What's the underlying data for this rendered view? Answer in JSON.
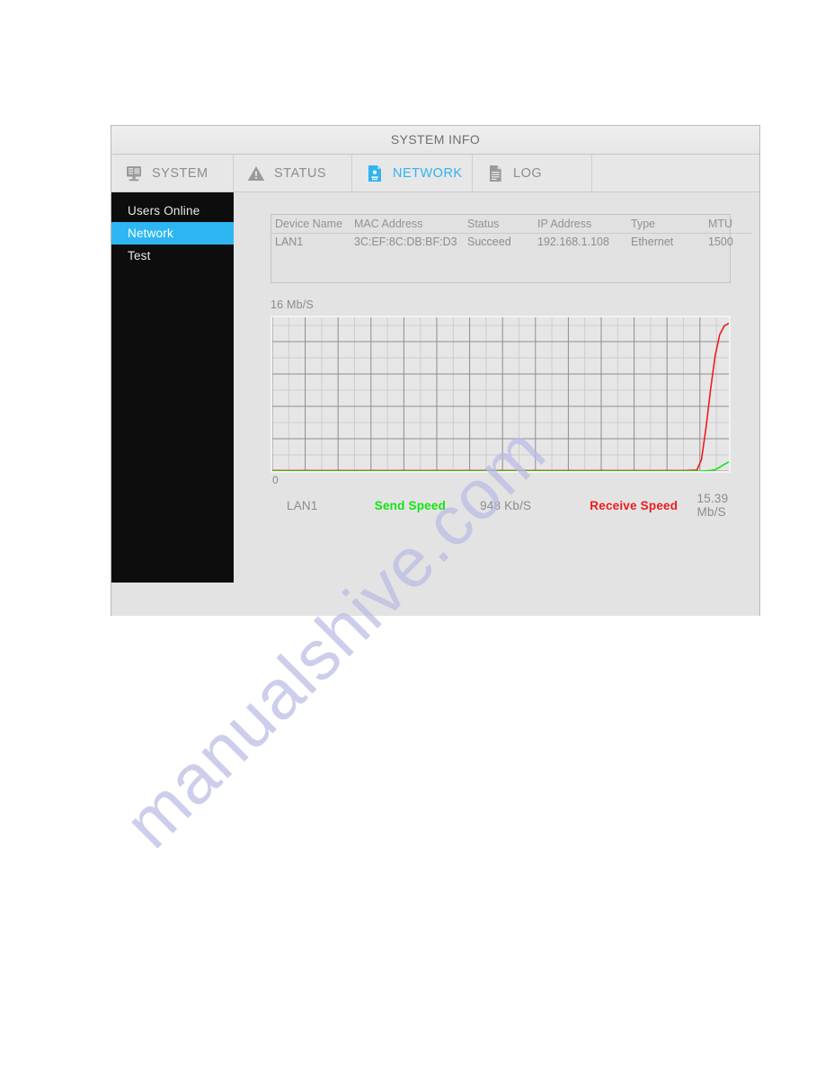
{
  "window": {
    "title": "SYSTEM INFO"
  },
  "tabs": [
    {
      "label": "SYSTEM",
      "icon": "monitor-icon",
      "active": false
    },
    {
      "label": "STATUS",
      "icon": "warning-triangle-icon",
      "active": false
    },
    {
      "label": "NETWORK",
      "icon": "network-card-icon",
      "active": true
    },
    {
      "label": "LOG",
      "icon": "document-icon",
      "active": false
    }
  ],
  "sidebar": {
    "items": [
      {
        "label": "Users Online",
        "selected": false
      },
      {
        "label": "Network",
        "selected": true
      },
      {
        "label": "Test",
        "selected": false
      }
    ]
  },
  "info_table": {
    "headers": [
      "Device Name",
      "MAC Address",
      "Status",
      "IP Address",
      "Type",
      "MTU"
    ],
    "rows": [
      {
        "device_name": "LAN1",
        "mac_address": "3C:EF:8C:DB:BF:D3",
        "status": "Succeed",
        "ip_address": "192.168.1.108",
        "type": "Ethernet",
        "mtu": "1500"
      }
    ]
  },
  "chart_data": {
    "type": "line",
    "title": "",
    "xlabel": "",
    "ylabel": "16 Mb/S",
    "axis_max_label": "16 Mb/S",
    "axis_min_label": "0",
    "ylim": [
      0,
      16
    ],
    "grid": true,
    "legend_position": "bottom",
    "series": [
      {
        "name": "Send Speed",
        "color": "#12e512",
        "current_value": "948 Kb/S",
        "unit": "Kb/S",
        "x": [
          0,
          10,
          20,
          30,
          40,
          50,
          60,
          70,
          80,
          90,
          94,
          96,
          97,
          98,
          99,
          100
        ],
        "values": [
          0,
          0,
          0,
          0,
          0,
          0,
          0,
          0,
          0,
          0,
          0,
          0.05,
          0.15,
          0.4,
          0.7,
          0.95
        ]
      },
      {
        "name": "Receive Speed",
        "color": "#ec1c1c",
        "current_value": "15.39 Mb/S",
        "unit": "Mb/S",
        "x": [
          0,
          10,
          20,
          30,
          40,
          50,
          60,
          70,
          80,
          90,
          93,
          94,
          95,
          96,
          97,
          98,
          99,
          100
        ],
        "values": [
          0.05,
          0.05,
          0.05,
          0.05,
          0.05,
          0.05,
          0.05,
          0.05,
          0.05,
          0.05,
          0.1,
          1.2,
          4.5,
          8.5,
          12.0,
          14.2,
          15.1,
          15.39
        ]
      }
    ],
    "legend": {
      "device": "LAN1",
      "send_label": "Send Speed",
      "send_value": "948 Kb/S",
      "receive_label": "Receive Speed",
      "receive_value": "15.39 Mb/S"
    }
  },
  "watermark": {
    "text": "manualshive.com"
  },
  "colors": {
    "accent": "#2db6f2",
    "send": "#12e512",
    "receive": "#ec1c1c",
    "sidebar_bg": "#0d0d0d",
    "dialog_bg": "#e3e3e3"
  }
}
